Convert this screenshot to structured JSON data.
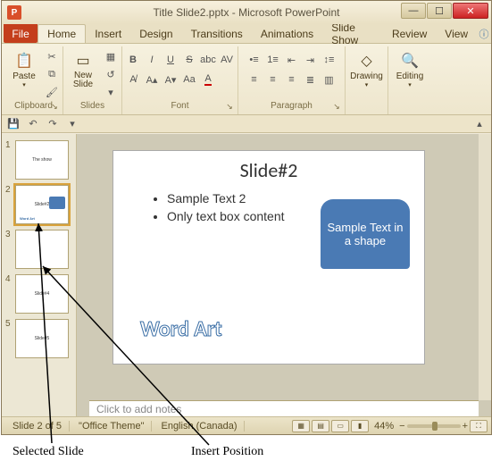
{
  "window": {
    "title": "Title Slide2.pptx - Microsoft PowerPoint",
    "app_letter": "P"
  },
  "tabs": {
    "file": "File",
    "home": "Home",
    "insert": "Insert",
    "design": "Design",
    "transitions": "Transitions",
    "animations": "Animations",
    "slideshow": "Slide Show",
    "review": "Review",
    "view": "View"
  },
  "ribbon": {
    "clipboard": {
      "label": "Clipboard",
      "paste": "Paste"
    },
    "slides": {
      "label": "Slides",
      "new_slide": "New\nSlide"
    },
    "font": {
      "label": "Font"
    },
    "paragraph": {
      "label": "Paragraph"
    },
    "drawing": {
      "label": "Drawing",
      "btn": "Drawing"
    },
    "editing": {
      "label": "Editing",
      "btn": "Editing"
    }
  },
  "thumbs": [
    {
      "num": "1",
      "label": "The show"
    },
    {
      "num": "2",
      "label": "Slide#2"
    },
    {
      "num": "3",
      "label": ""
    },
    {
      "num": "4",
      "label": "Slide#4"
    },
    {
      "num": "5",
      "label": "Slide#5"
    }
  ],
  "slide": {
    "title": "Slide#2",
    "bullet1": "Sample Text 2",
    "bullet2": "Only text box content",
    "shape_text": "Sample Text in a shape",
    "wordart": "Word Art"
  },
  "notes_placeholder": "Click to add notes",
  "status": {
    "slide_of": "Slide 2 of 5",
    "theme": "\"Office Theme\"",
    "lang": "English (Canada)",
    "zoom": "44%"
  },
  "annotations": {
    "selected_slide": "Selected Slide",
    "insert_position": "Insert Position"
  }
}
